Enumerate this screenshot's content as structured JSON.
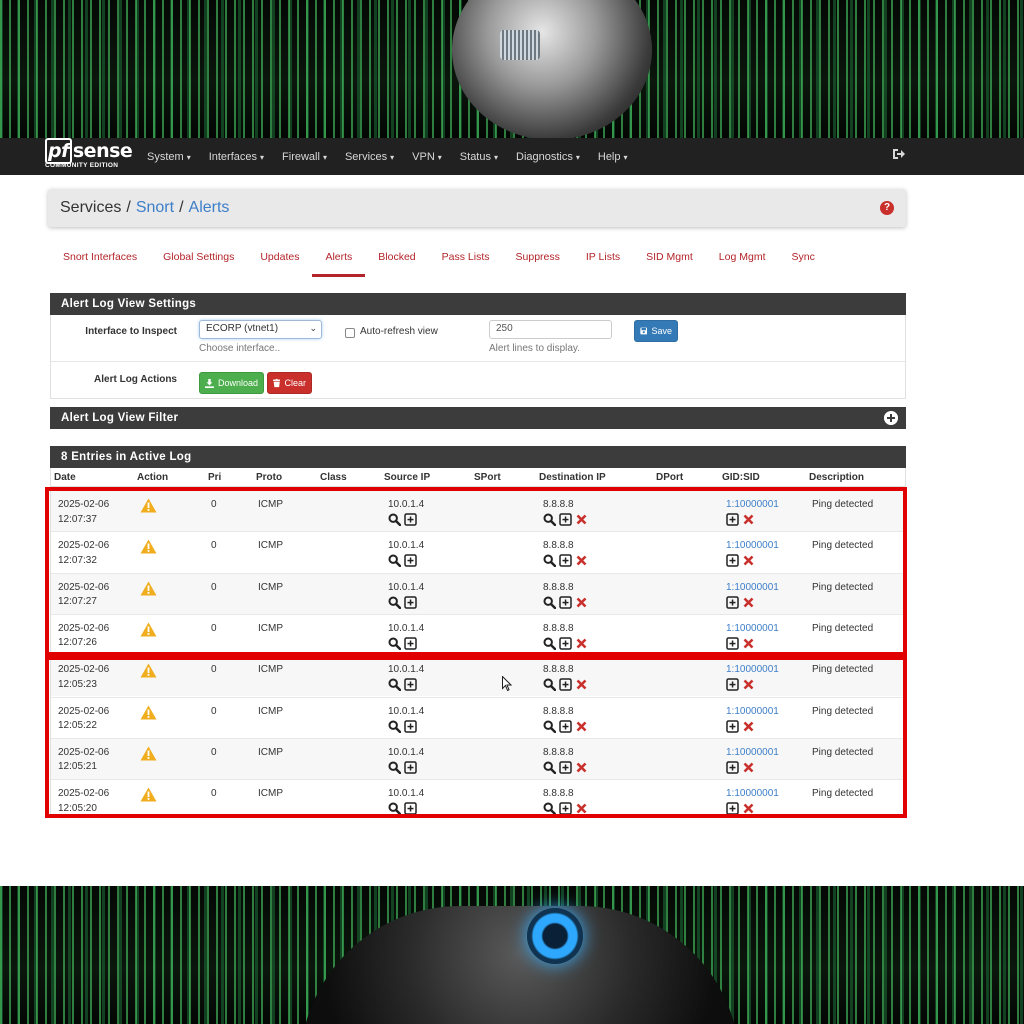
{
  "colors": {
    "nav_bg": "#212121",
    "accent_red": "#b3242a",
    "link_blue": "#3d7ec9",
    "highlight_red": "#e00000",
    "save_blue": "#337ab7",
    "download_green": "#4cae4c",
    "clear_red": "#c9302c"
  },
  "logo": {
    "main_pf": "pf",
    "main_rest": "sense",
    "sub": "COMMUNITY EDITION"
  },
  "nav": {
    "items": [
      {
        "label": "System",
        "caret": "▾"
      },
      {
        "label": "Interfaces",
        "caret": "▾"
      },
      {
        "label": "Firewall",
        "caret": "▾"
      },
      {
        "label": "Services",
        "caret": "▾"
      },
      {
        "label": "VPN",
        "caret": "▾"
      },
      {
        "label": "Status",
        "caret": "▾"
      },
      {
        "label": "Diagnostics",
        "caret": "▾"
      },
      {
        "label": "Help",
        "caret": "▾"
      }
    ],
    "logout_icon": "sign-out-icon"
  },
  "breadcrumb": {
    "part1": "Services",
    "sep1": "/",
    "part2": "Snort",
    "sep2": "/",
    "part3": "Alerts",
    "help_icon": "question-circle-icon",
    "help_glyph": "?"
  },
  "tabs": [
    {
      "label": "Snort Interfaces"
    },
    {
      "label": "Global Settings"
    },
    {
      "label": "Updates"
    },
    {
      "label": "Alerts",
      "active": true
    },
    {
      "label": "Blocked"
    },
    {
      "label": "Pass Lists"
    },
    {
      "label": "Suppress"
    },
    {
      "label": "IP Lists"
    },
    {
      "label": "SID Mgmt"
    },
    {
      "label": "Log Mgmt"
    },
    {
      "label": "Sync"
    }
  ],
  "settings": {
    "title": "Alert Log View Settings",
    "interface_label": "Interface to Inspect",
    "interface_value": "ECORP (vtnet1)",
    "interface_help": "Choose interface..",
    "autorefresh_label": "Auto-refresh view",
    "autorefresh_checked": false,
    "lines_value": "250",
    "lines_help": "Alert lines to display.",
    "save_label": "Save",
    "actions_label": "Alert Log Actions",
    "download_label": "Download",
    "clear_label": "Clear"
  },
  "filter": {
    "title": "Alert Log View Filter",
    "expand_icon": "plus-circle-icon"
  },
  "log": {
    "title": "8 Entries in Active Log",
    "columns": [
      "Date",
      "Action",
      "Pri",
      "Proto",
      "Class",
      "Source IP",
      "SPort",
      "Destination IP",
      "DPort",
      "GID:SID",
      "Description"
    ],
    "rows": [
      {
        "date": "2025-02-06",
        "time": "12:07:37",
        "pri": "0",
        "proto": "ICMP",
        "class": "",
        "src": "10.0.1.4",
        "sport": "",
        "dst": "8.8.8.8",
        "dport": "",
        "gidsid": "1:10000001",
        "desc": "Ping detected"
      },
      {
        "date": "2025-02-06",
        "time": "12:07:32",
        "pri": "0",
        "proto": "ICMP",
        "class": "",
        "src": "10.0.1.4",
        "sport": "",
        "dst": "8.8.8.8",
        "dport": "",
        "gidsid": "1:10000001",
        "desc": "Ping detected"
      },
      {
        "date": "2025-02-06",
        "time": "12:07:27",
        "pri": "0",
        "proto": "ICMP",
        "class": "",
        "src": "10.0.1.4",
        "sport": "",
        "dst": "8.8.8.8",
        "dport": "",
        "gidsid": "1:10000001",
        "desc": "Ping detected"
      },
      {
        "date": "2025-02-06",
        "time": "12:07:26",
        "pri": "0",
        "proto": "ICMP",
        "class": "",
        "src": "10.0.1.4",
        "sport": "",
        "dst": "8.8.8.8",
        "dport": "",
        "gidsid": "1:10000001",
        "desc": "Ping detected"
      },
      {
        "date": "2025-02-06",
        "time": "12:05:23",
        "pri": "0",
        "proto": "ICMP",
        "class": "",
        "src": "10.0.1.4",
        "sport": "",
        "dst": "8.8.8.8",
        "dport": "",
        "gidsid": "1:10000001",
        "desc": "Ping detected"
      },
      {
        "date": "2025-02-06",
        "time": "12:05:22",
        "pri": "0",
        "proto": "ICMP",
        "class": "",
        "src": "10.0.1.4",
        "sport": "",
        "dst": "8.8.8.8",
        "dport": "",
        "gidsid": "1:10000001",
        "desc": "Ping detected"
      },
      {
        "date": "2025-02-06",
        "time": "12:05:21",
        "pri": "0",
        "proto": "ICMP",
        "class": "",
        "src": "10.0.1.4",
        "sport": "",
        "dst": "8.8.8.8",
        "dport": "",
        "gidsid": "1:10000001",
        "desc": "Ping detected"
      },
      {
        "date": "2025-02-06",
        "time": "12:05:20",
        "pri": "0",
        "proto": "ICMP",
        "class": "",
        "src": "10.0.1.4",
        "sport": "",
        "dst": "8.8.8.8",
        "dport": "",
        "gidsid": "1:10000001",
        "desc": "Ping detected"
      }
    ]
  }
}
